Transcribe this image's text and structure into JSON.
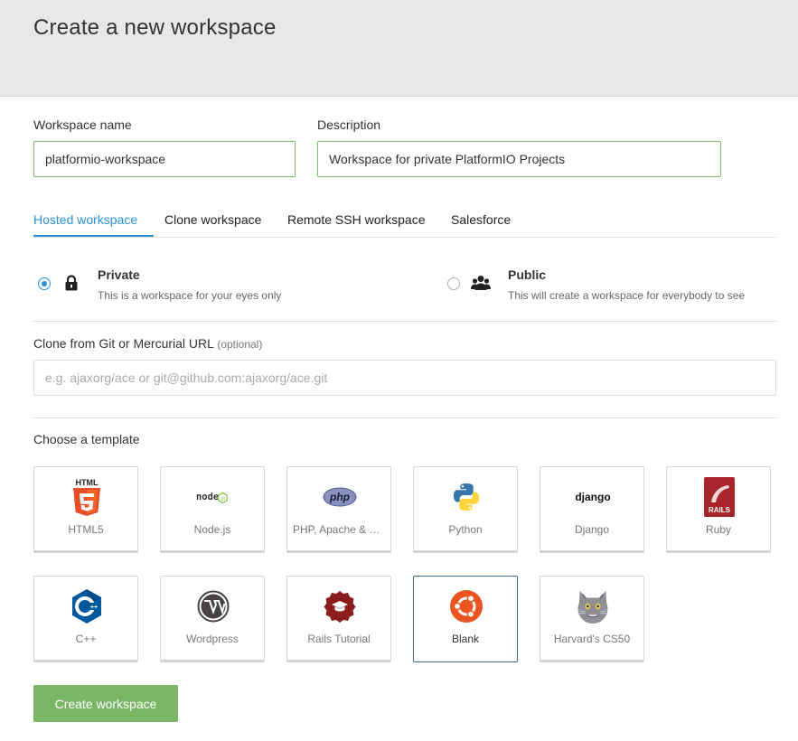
{
  "page_title": "Create a new workspace",
  "workspace_name": {
    "label": "Workspace name",
    "value": "platformio-workspace"
  },
  "description": {
    "label": "Description",
    "value": "Workspace for private PlatformIO Projects"
  },
  "tabs": [
    {
      "label": "Hosted workspace",
      "active": true
    },
    {
      "label": "Clone workspace",
      "active": false
    },
    {
      "label": "Remote SSH workspace",
      "active": false
    },
    {
      "label": "Salesforce",
      "active": false
    }
  ],
  "visibility": {
    "private": {
      "title": "Private",
      "desc": "This is a workspace for your eyes only",
      "icon": "lock-icon",
      "checked": true
    },
    "public": {
      "title": "Public",
      "desc": "This will create a workspace for everybody to see",
      "icon": "users-icon",
      "checked": false
    }
  },
  "clone": {
    "label": "Clone from Git or Mercurial URL",
    "optional": "(optional)",
    "placeholder": "e.g. ajaxorg/ace or git@github.com:ajaxorg/ace.git"
  },
  "templates_label": "Choose a template",
  "templates": [
    {
      "label": "HTML5",
      "icon": "html5-icon"
    },
    {
      "label": "Node.js",
      "icon": "nodejs-icon"
    },
    {
      "label": "PHP, Apache & MySQL",
      "icon": "php-icon"
    },
    {
      "label": "Python",
      "icon": "python-icon"
    },
    {
      "label": "Django",
      "icon": "django-icon"
    },
    {
      "label": "Ruby",
      "icon": "rails-icon"
    },
    {
      "label": "C++",
      "icon": "cpp-icon"
    },
    {
      "label": "Wordpress",
      "icon": "wordpress-icon"
    },
    {
      "label": "Rails Tutorial",
      "icon": "rails-tutorial-icon"
    },
    {
      "label": "Blank",
      "icon": "ubuntu-icon",
      "selected": true
    },
    {
      "label": "Harvard's CS50",
      "icon": "cs50-cat-icon"
    }
  ],
  "logo_text": {
    "html": "HTML",
    "node": "node",
    "php": "php",
    "django": "django",
    "rails": "RAILS"
  },
  "create_button": "Create workspace",
  "colors": {
    "accent": "#2b8fd7",
    "button": "#7ab665",
    "input_border": "#7bbf6a",
    "selected_card": "#3a6a8f"
  }
}
